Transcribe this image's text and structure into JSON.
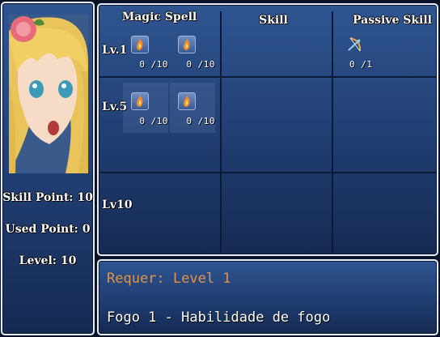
{
  "status": {
    "skill_point": "Skill Point: 10",
    "used_point": "Used Point: 0",
    "level": "Level: 10"
  },
  "grid": {
    "columns": [
      "Magic Spell",
      "Skill",
      "Passive Skill"
    ],
    "rows": [
      "Lv.1",
      "Lv.5",
      "Lv10"
    ],
    "skills": [
      {
        "icon": "fire-scroll-icon",
        "count": "0 /10"
      },
      {
        "icon": "fire-scroll-icon",
        "count": "0 /10"
      },
      {
        "icon": "bow-arrow-icon",
        "count": "0 /1"
      },
      {
        "icon": "fire-scroll-icon",
        "count": "0 /10"
      },
      {
        "icon": "fire-scroll-icon",
        "count": "0 /10"
      }
    ]
  },
  "info": {
    "requirement": "Requer: Level 1",
    "description": "Fogo 1 - Habilidade de fogo"
  },
  "colors": {
    "requirement_text": "#e0934a",
    "window_top": "#2f5591",
    "window_bottom": "#152a52"
  }
}
